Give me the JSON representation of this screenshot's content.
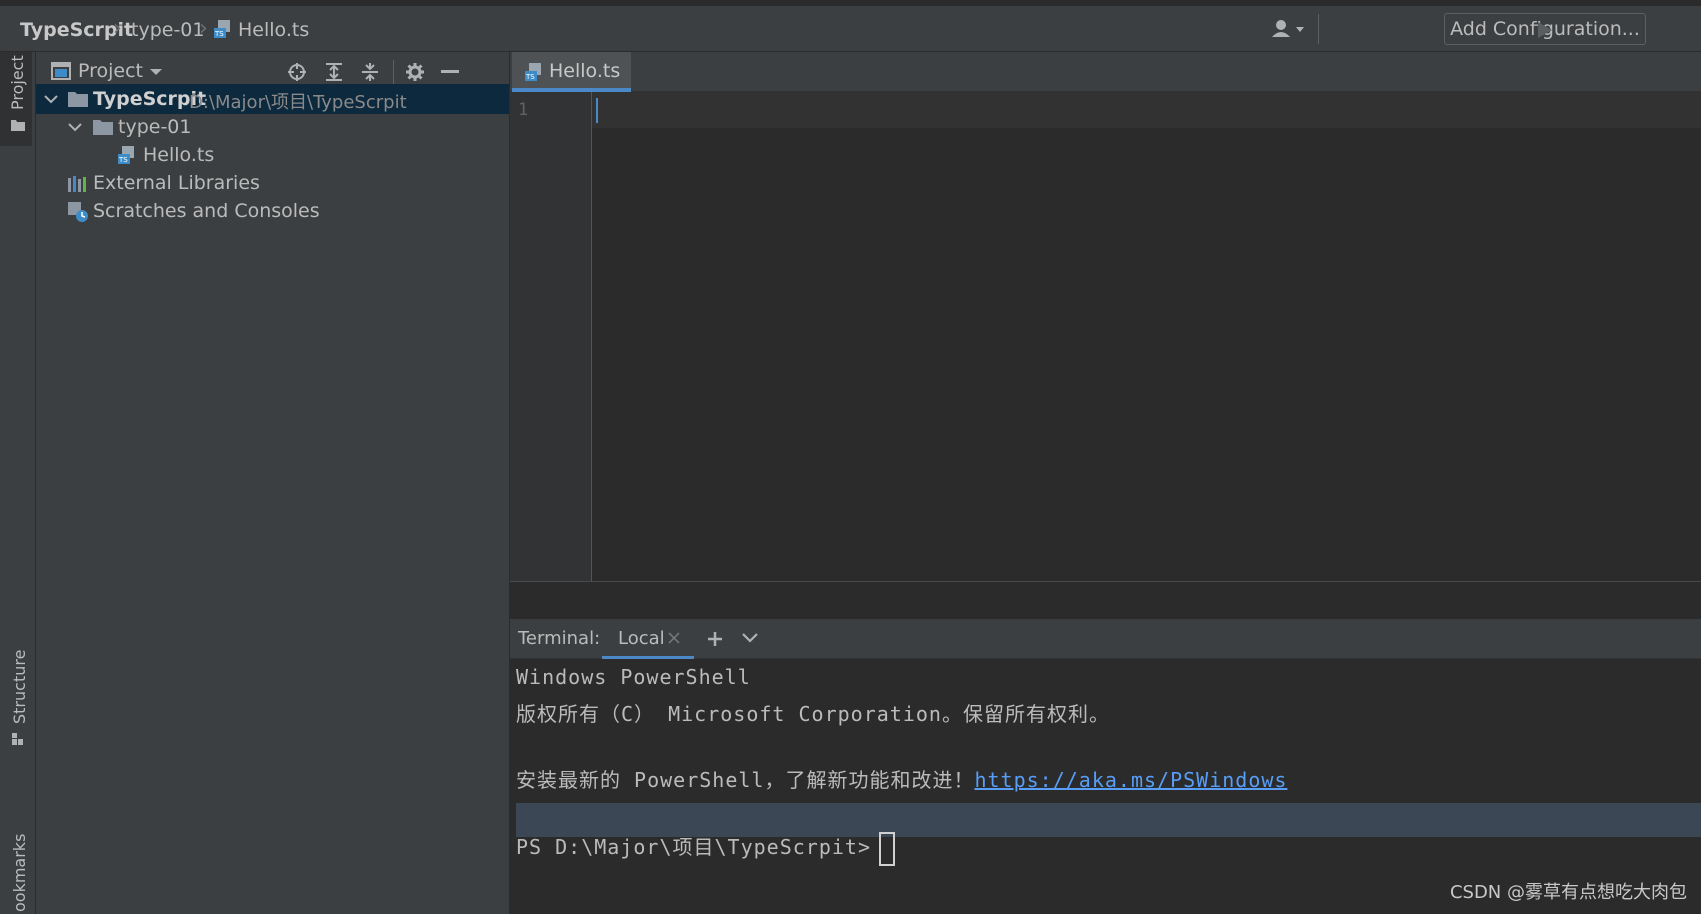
{
  "navbar": {
    "breadcrumb": [
      "TypeScrpit",
      "type-01",
      "Hello.ts"
    ],
    "add_configuration": "Add Configuration..."
  },
  "sidebar": {
    "project_label": "Project",
    "structure_label": "Structure",
    "bookmarks_label": "ookmarks"
  },
  "project_panel": {
    "title": "Project",
    "tree": {
      "root_name": "TypeScrpit",
      "root_path": "D:\\Major\\项目\\TypeScrpit",
      "folder": "type-01",
      "file": "Hello.ts",
      "external": "External Libraries",
      "scratches": "Scratches and Consoles"
    }
  },
  "editor": {
    "tab_label": "Hello.ts",
    "line_number": "1"
  },
  "terminal": {
    "label": "Terminal:",
    "tab_local": "Local",
    "lines": {
      "l1": "Windows PowerShell",
      "l2": "版权所有（C） Microsoft Corporation。保留所有权利。",
      "l3_prefix": "安装最新的 PowerShell，了解新功能和改进！",
      "l3_link": "https://aka.ms/PSWindows",
      "prompt": "PS D:\\Major\\项目\\TypeScrpit>"
    }
  },
  "watermark": "CSDN @雾草有点想吃大肉包",
  "colors": {
    "accent": "#4a88c7",
    "selection": "#0d293e",
    "link": "#589df6",
    "folder": "#8c97a3"
  }
}
